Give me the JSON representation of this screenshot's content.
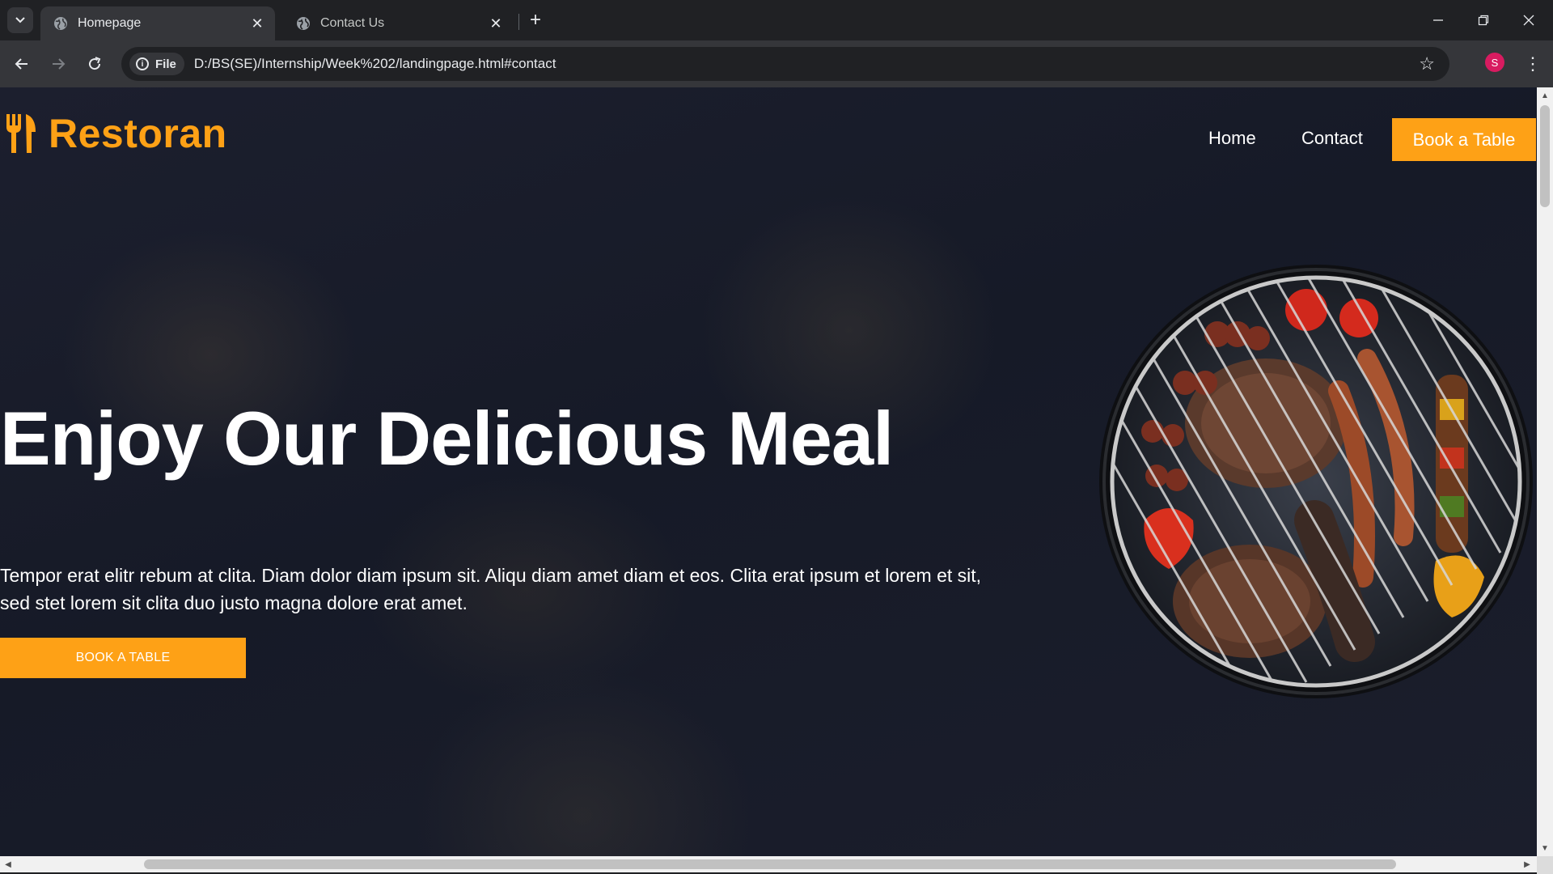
{
  "browser": {
    "tabs": [
      {
        "title": "Homepage",
        "active": true
      },
      {
        "title": "Contact Us",
        "active": false
      }
    ],
    "address": {
      "scheme_chip": "File",
      "url": "D:/BS(SE)/Internship/Week%202/landingpage.html#contact"
    },
    "profile_initial": "S",
    "icons": [
      "tab-search-icon",
      "globe-icon",
      "close-icon",
      "plus-icon",
      "minimize-icon",
      "restore-icon",
      "back-icon",
      "forward-icon",
      "reload-icon",
      "info-icon",
      "star-icon",
      "kebab-menu-icon"
    ]
  },
  "site": {
    "brand": "Restoran",
    "nav": {
      "home": "Home",
      "contact": "Contact",
      "cta": "Book a Table"
    },
    "hero": {
      "title": "Enjoy Our Delicious Meal",
      "text": "Tempor erat elitr rebum at clita. Diam dolor diam ipsum sit. Aliqu diam amet diam et eos. Clita erat ipsum et lorem et sit, sed stet lorem sit clita duo justo magna dolore erat amet.",
      "button": "BOOK A TABLE"
    }
  },
  "colors": {
    "accent": "#fea116",
    "chrome_dark": "#202124",
    "chrome_mid": "#35363a",
    "hero_bg": "#1a1d2b"
  }
}
